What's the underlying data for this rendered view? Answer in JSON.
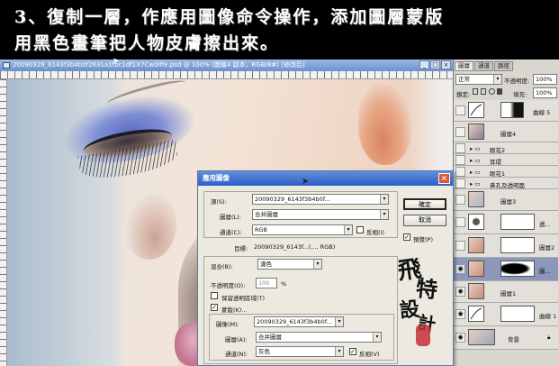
{
  "banner": {
    "line1": "3、復制一層，作應用圖像命令操作，添加圖層蒙版",
    "line2": "用黑色畫筆把人物皮膚擦出來。"
  },
  "document": {
    "title": "20090329_6143f3b4b0f2631a1fbc1df1X7Cw0iffe.psd @ 100% (圖層4 副本，RGB/8#) [修改后]",
    "win_min": "_",
    "win_max": "□",
    "win_close": "×"
  },
  "layers_panel": {
    "tabs": [
      "圖層",
      "通道",
      "路徑"
    ],
    "blend_mode": "正常",
    "opacity_label": "不透明度:",
    "opacity_value": "100%",
    "lock_label": "鎖定:",
    "fill_label": "填充:",
    "fill_value": "100%",
    "arrow": "▾",
    "layers": [
      {
        "name": "曲線 5"
      },
      {
        "name": "圖層4"
      },
      {
        "name": "眼花2"
      },
      {
        "name": "耳環"
      },
      {
        "name": "眼花1"
      },
      {
        "name": "鼻孔及透明面"
      },
      {
        "name": "圖層3"
      },
      {
        "name": "透..."
      },
      {
        "name": "圖層2"
      },
      {
        "name": "圖..."
      },
      {
        "name": "圖層1"
      },
      {
        "name": "曲線 1"
      },
      {
        "name": "背景"
      }
    ]
  },
  "dialog": {
    "title": "應用圖像",
    "close": "×",
    "source_label": "源(S):",
    "source_value": "20090329_6143f3b4b0f...",
    "layer_label": "圖層(L):",
    "layer_value": "合并圖層",
    "channel_label": "通道(C):",
    "channel_value": "RGB",
    "invert_label": "反相(I)",
    "target_label": "目標:",
    "target_value": "20090329_6143f...(..., RGB)",
    "blending_label": "混合(B):",
    "blending_value": "濾色",
    "opacity_label": "不透明度(O):",
    "opacity_value": "100",
    "opacity_unit": "%",
    "preserve_label": "保留透明區域(T)",
    "mask_label": "蒙版(K)...",
    "mask_image_label": "圖像(M):",
    "mask_image_value": "20090329_6143f3b4b0f...",
    "mask_layer_label": "圖層(A):",
    "mask_layer_value": "合并圖層",
    "mask_channel_label": "通道(N):",
    "mask_channel_value": "灰色",
    "mask_invert_label": "反相(V)",
    "ok_button": "確定",
    "cancel_button": "取消",
    "preview_label": "預覽(P)",
    "check": "✓",
    "arrow": "▾"
  },
  "signature": {
    "chars": [
      "飛",
      "特",
      "設",
      "計"
    ]
  },
  "colors": {
    "accent": "#2c5fc6",
    "panel": "#d9d6cf",
    "selected_layer": "#8c98b9"
  }
}
